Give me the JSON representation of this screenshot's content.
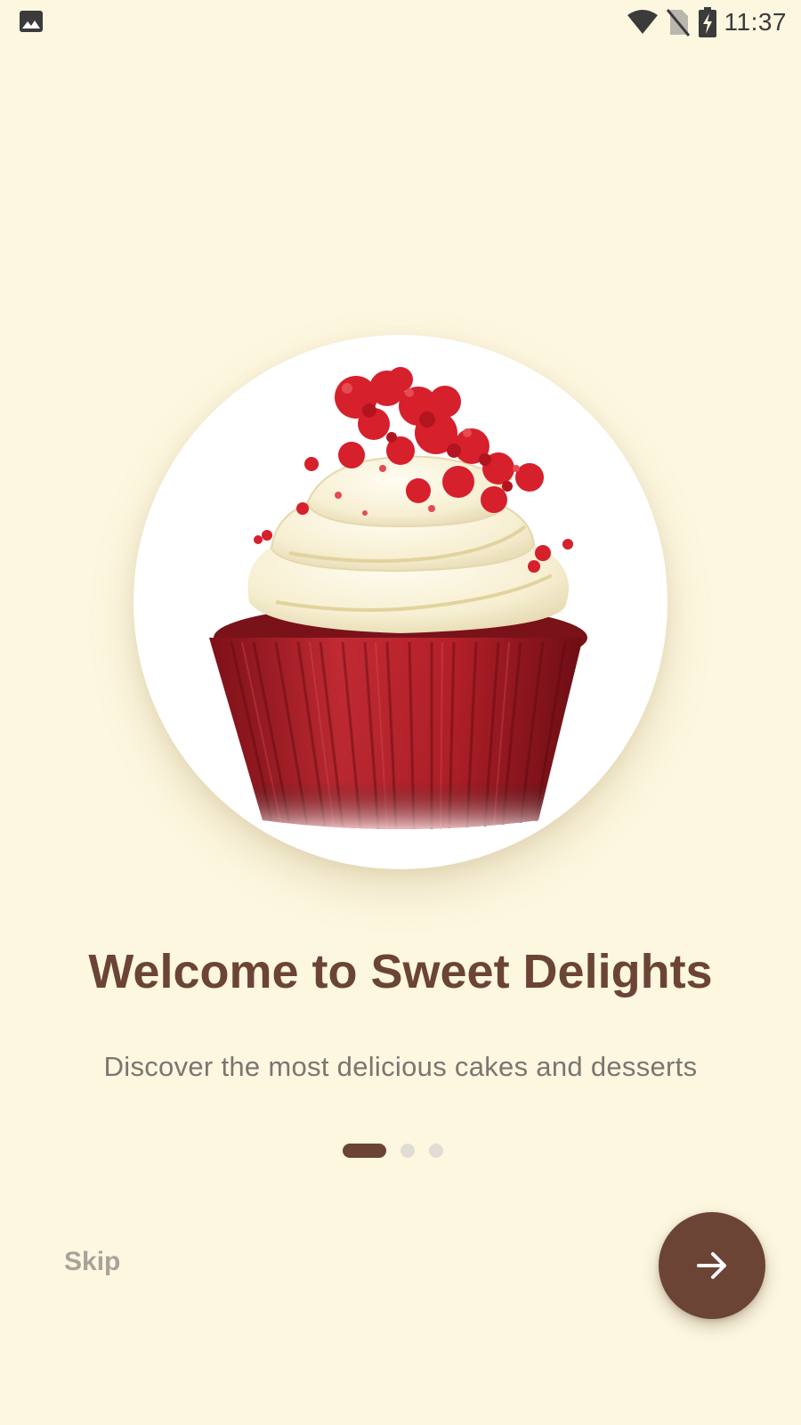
{
  "status_bar": {
    "time": "11:37",
    "left_icon": "gallery-icon",
    "right_icons": [
      "wifi-icon",
      "no-sim-icon",
      "battery-charging-icon"
    ]
  },
  "onboarding": {
    "image": "red-velvet-cupcake",
    "title": "Welcome to Sweet Delights",
    "subtitle": "Discover the most delicious cakes and desserts",
    "page_indicator": {
      "current": 1,
      "total": 3
    },
    "skip_label": "Skip",
    "next_icon": "arrow-right-icon"
  },
  "colors": {
    "background": "#fdf7e0",
    "primary": "#6b4435",
    "muted_text": "#7a7670",
    "skip_text": "#a7a39b",
    "inactive_dot": "#e1ddd4"
  }
}
